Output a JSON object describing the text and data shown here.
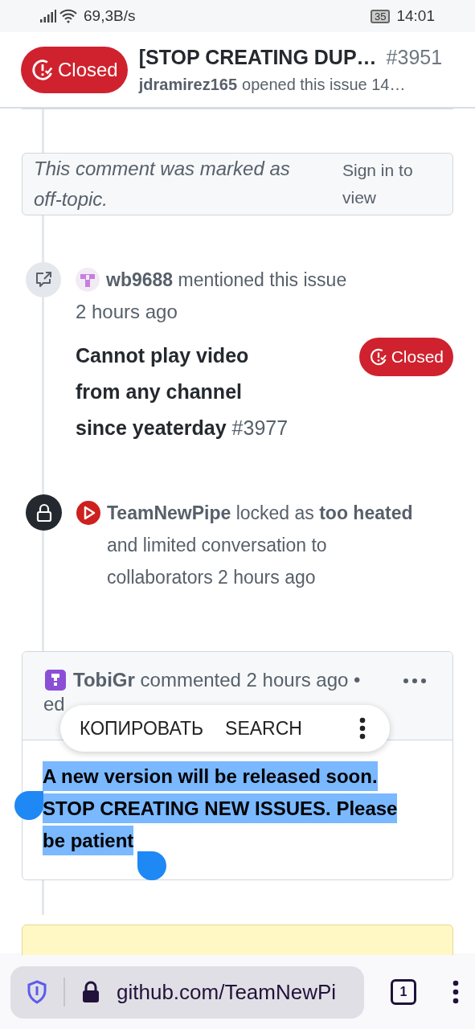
{
  "status_bar": {
    "network_speed": "69,3B/s",
    "battery": "35",
    "time": "14:01"
  },
  "header": {
    "state": {
      "label": "Closed",
      "kind": "closed"
    },
    "title": "[STOP CREATING DUP…",
    "number": "#3951",
    "author": "jdramirez165",
    "meta": "opened this issue 14…"
  },
  "timeline": [
    {
      "kind": "hidden_comment",
      "text": "This comment was marked as off-topic.",
      "action": "Sign in to view"
    },
    {
      "kind": "mention",
      "text": "**wb9688** mentioned this issue",
      "time": "2 hours ago",
      "issue": {
        "title": "Cannot play video from any channel since yeaterday",
        "number": "#3977",
        "state": "Closed"
      }
    },
    {
      "kind": "lock",
      "text": "**TeamNewPipe** locked as **too heated** and limited conversation to collaborators 2 hours ago"
    },
    {
      "kind": "comment",
      "text": "**TobiGr** commented 2 hours ago •",
      "edited": "ed",
      "body": "A new version will be released soon. STOP CREATING NEW ISSUES. Please be patient",
      "body_selected": true
    }
  ],
  "selection_menu": {
    "actions": [
      "КОПИРОВАТЬ",
      "SEARCH"
    ]
  },
  "browser_bar": {
    "url": "github.com/TeamNewPi",
    "tab_count": "1"
  }
}
